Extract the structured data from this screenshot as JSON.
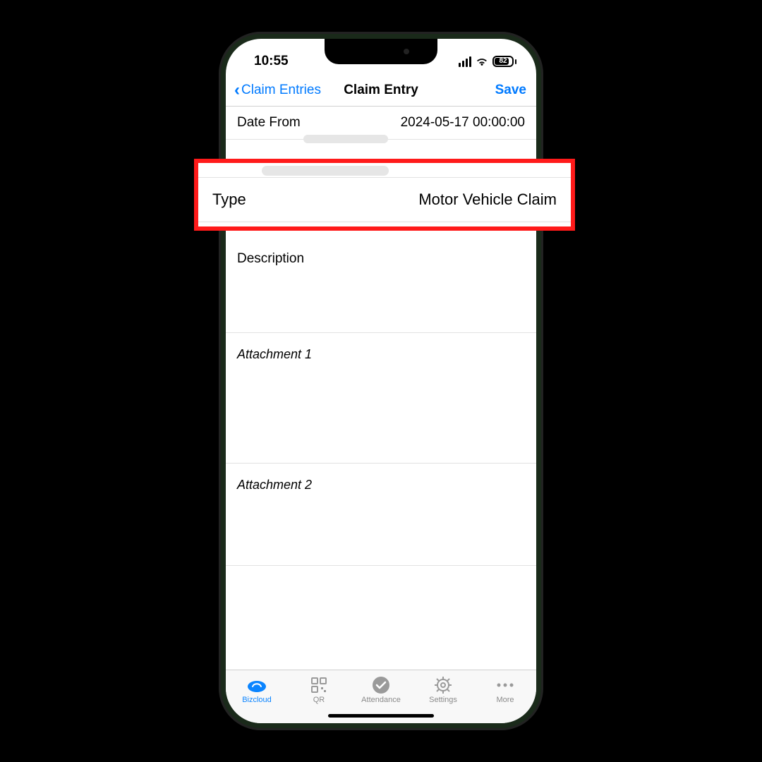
{
  "status": {
    "time": "10:55",
    "battery": "82"
  },
  "nav": {
    "back_label": "Claim Entries",
    "title": "Claim Entry",
    "save_label": "Save"
  },
  "rows": {
    "date_from": {
      "label": "Date From",
      "value": "2024-05-17 00:00:00"
    }
  },
  "sections": {
    "description_label": "Description",
    "attachment1_label": "Attachment 1",
    "attachment2_label": "Attachment 2"
  },
  "highlight": {
    "label": "Type",
    "value": "Motor Vehicle Claim"
  },
  "tabs": [
    {
      "key": "bizcloud",
      "label": "Bizcloud"
    },
    {
      "key": "qr",
      "label": "QR"
    },
    {
      "key": "attendance",
      "label": "Attendance"
    },
    {
      "key": "settings",
      "label": "Settings"
    },
    {
      "key": "more",
      "label": "More"
    }
  ]
}
